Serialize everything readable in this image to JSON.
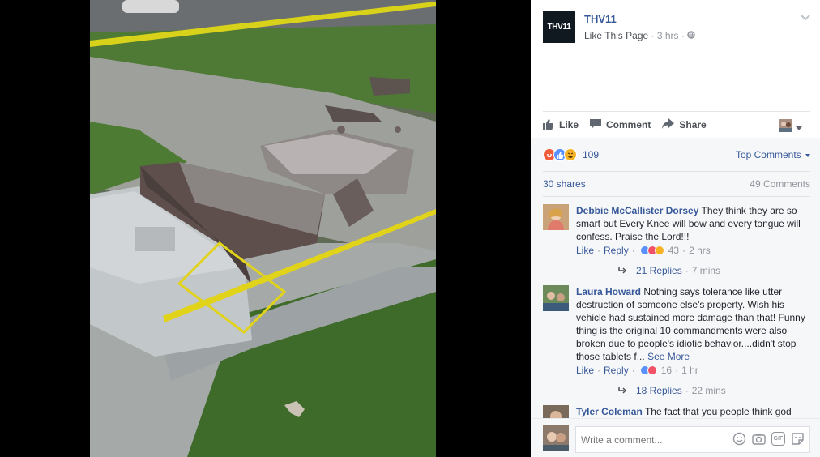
{
  "post": {
    "page_name": "THV11",
    "logo_text": "THV11",
    "like_page": "Like This Page",
    "time": "3 hrs",
    "separator": "·"
  },
  "actions": {
    "like": "Like",
    "comment": "Comment",
    "share": "Share"
  },
  "reactions": {
    "count": "109",
    "top_comments": "Top Comments",
    "shares": "30 shares",
    "comments_count": "49 Comments"
  },
  "comments": [
    {
      "name": "Debbie McCallister Dorsey",
      "text": "They think they are so smart but Every Knee will bow and every tongue will confess. Praise the Lord!!!",
      "like": "Like",
      "reply": "Reply",
      "reactions": "43",
      "time": "2 hrs",
      "replies": "21 Replies",
      "replies_time": "7 mins"
    },
    {
      "name": "Laura Howard",
      "text": "Nothing says tolerance like utter destruction of someone else's property. Wish his vehicle had sustained more damage than that! Funny thing is the original 10 commandments were also broken due to people's idiotic behavior....didn't stop those tablets f...",
      "see_more": "See More",
      "like": "Like",
      "reply": "Reply",
      "reactions": "16",
      "time": "1 hr",
      "replies": "18 Replies",
      "replies_time": "22 mins"
    },
    {
      "name": "Tyler Coleman",
      "text": "The fact that you people think god"
    }
  ],
  "composer": {
    "placeholder": "Write a comment..."
  },
  "colors": {
    "link": "#365899",
    "muted": "#90949c",
    "like_blue": "#5890ff",
    "love_red": "#f25268",
    "angry": "#f15c3b",
    "haha": "#f7b125"
  }
}
